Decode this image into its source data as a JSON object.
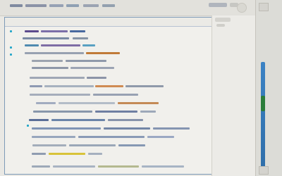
{
  "window": {
    "title": ""
  },
  "toolbar": {
    "tabs": [
      "",
      "",
      "",
      "",
      "",
      ""
    ],
    "actions": [
      "",
      "",
      ""
    ]
  },
  "editor": {
    "header": "",
    "lines": [
      "",
      "",
      "",
      "",
      "",
      "",
      "",
      "",
      "",
      "",
      "",
      "",
      "",
      "",
      "",
      "",
      "",
      "",
      "",
      "",
      "",
      "",
      "",
      ""
    ]
  },
  "colors": {
    "editor_border": "#7d9ab7",
    "scroll_track": "#3b82c4",
    "scroll_thumb": "#2b7d3a",
    "accent_teal": "#24a6c9",
    "accent_orange": "#c77d29",
    "accent_yellow": "#d8c33a"
  }
}
